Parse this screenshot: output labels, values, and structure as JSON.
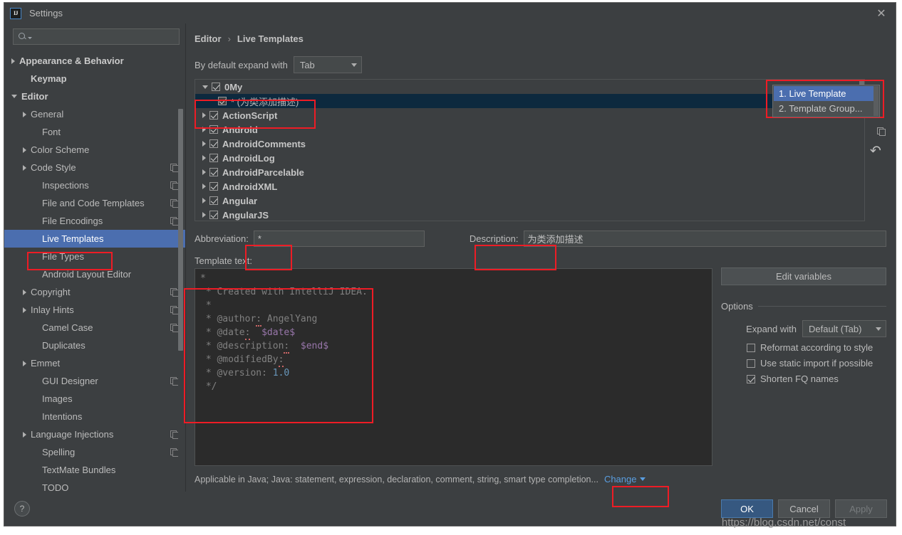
{
  "window": {
    "title": "Settings",
    "logo_text": "IJ",
    "close_label": "✕"
  },
  "search": {
    "value": "",
    "placeholder": ""
  },
  "sidebar": {
    "items": [
      {
        "label": "Appearance & Behavior",
        "arrow": "right",
        "bold": true,
        "indent": 0,
        "copy": false,
        "selected": false
      },
      {
        "label": "Keymap",
        "arrow": "none",
        "bold": true,
        "indent": 1,
        "copy": false,
        "selected": false
      },
      {
        "label": "Editor",
        "arrow": "down",
        "bold": true,
        "indent": 0,
        "copy": false,
        "selected": false
      },
      {
        "label": "General",
        "arrow": "right",
        "bold": false,
        "indent": 1,
        "copy": false,
        "selected": false
      },
      {
        "label": "Font",
        "arrow": "none",
        "bold": false,
        "indent": 2,
        "copy": false,
        "selected": false
      },
      {
        "label": "Color Scheme",
        "arrow": "right",
        "bold": false,
        "indent": 1,
        "copy": false,
        "selected": false
      },
      {
        "label": "Code Style",
        "arrow": "right",
        "bold": false,
        "indent": 1,
        "copy": true,
        "selected": false
      },
      {
        "label": "Inspections",
        "arrow": "none",
        "bold": false,
        "indent": 2,
        "copy": true,
        "selected": false
      },
      {
        "label": "File and Code Templates",
        "arrow": "none",
        "bold": false,
        "indent": 2,
        "copy": true,
        "selected": false
      },
      {
        "label": "File Encodings",
        "arrow": "none",
        "bold": false,
        "indent": 2,
        "copy": true,
        "selected": false
      },
      {
        "label": "Live Templates",
        "arrow": "none",
        "bold": false,
        "indent": 2,
        "copy": false,
        "selected": true
      },
      {
        "label": "File Types",
        "arrow": "none",
        "bold": false,
        "indent": 2,
        "copy": false,
        "selected": false
      },
      {
        "label": "Android Layout Editor",
        "arrow": "none",
        "bold": false,
        "indent": 2,
        "copy": false,
        "selected": false
      },
      {
        "label": "Copyright",
        "arrow": "right",
        "bold": false,
        "indent": 1,
        "copy": true,
        "selected": false
      },
      {
        "label": "Inlay Hints",
        "arrow": "right",
        "bold": false,
        "indent": 1,
        "copy": true,
        "selected": false
      },
      {
        "label": "Camel Case",
        "arrow": "none",
        "bold": false,
        "indent": 2,
        "copy": true,
        "selected": false
      },
      {
        "label": "Duplicates",
        "arrow": "none",
        "bold": false,
        "indent": 2,
        "copy": false,
        "selected": false
      },
      {
        "label": "Emmet",
        "arrow": "right",
        "bold": false,
        "indent": 1,
        "copy": false,
        "selected": false
      },
      {
        "label": "GUI Designer",
        "arrow": "none",
        "bold": false,
        "indent": 2,
        "copy": true,
        "selected": false
      },
      {
        "label": "Images",
        "arrow": "none",
        "bold": false,
        "indent": 2,
        "copy": false,
        "selected": false
      },
      {
        "label": "Intentions",
        "arrow": "none",
        "bold": false,
        "indent": 2,
        "copy": false,
        "selected": false
      },
      {
        "label": "Language Injections",
        "arrow": "right",
        "bold": false,
        "indent": 1,
        "copy": true,
        "selected": false
      },
      {
        "label": "Spelling",
        "arrow": "none",
        "bold": false,
        "indent": 2,
        "copy": true,
        "selected": false
      },
      {
        "label": "TextMate Bundles",
        "arrow": "none",
        "bold": false,
        "indent": 2,
        "copy": false,
        "selected": false
      },
      {
        "label": "TODO",
        "arrow": "none",
        "bold": false,
        "indent": 2,
        "copy": false,
        "selected": false
      }
    ]
  },
  "breadcrumb": {
    "parent": "Editor",
    "separator": "›",
    "current": "Live Templates"
  },
  "expand": {
    "label": "By default expand with",
    "value": "Tab"
  },
  "templates": {
    "rows": [
      {
        "label": "0My",
        "arrow": "down",
        "checked": true,
        "child": false
      },
      {
        "label": "* (为类添加描述)",
        "arrow": "none",
        "checked": true,
        "child": true,
        "selected": true
      },
      {
        "label": "ActionScript",
        "arrow": "right",
        "checked": true,
        "child": false
      },
      {
        "label": "Android",
        "arrow": "right",
        "checked": true,
        "child": false
      },
      {
        "label": "AndroidComments",
        "arrow": "right",
        "checked": true,
        "child": false
      },
      {
        "label": "AndroidLog",
        "arrow": "right",
        "checked": true,
        "child": false
      },
      {
        "label": "AndroidParcelable",
        "arrow": "right",
        "checked": true,
        "child": false
      },
      {
        "label": "AndroidXML",
        "arrow": "right",
        "checked": true,
        "child": false
      },
      {
        "label": "Angular",
        "arrow": "right",
        "checked": true,
        "child": false
      },
      {
        "label": "AngularJS",
        "arrow": "right",
        "checked": true,
        "child": false
      }
    ]
  },
  "list_toolbar": {
    "add": "+",
    "remove": "−",
    "duplicate": "duplicate-icon",
    "revert": "↶"
  },
  "add_popup": {
    "items": [
      {
        "label": "1. Live Template",
        "selected": true
      },
      {
        "label": "2. Template Group...",
        "selected": false
      }
    ]
  },
  "fields": {
    "abbreviation_label": "Abbreviation:",
    "abbreviation_value": "*",
    "description_label": "Description:",
    "description_value": "为类添加描述"
  },
  "template_text": {
    "label": "Template text:",
    "lines": [
      [
        {
          "t": "*",
          "c": "c"
        }
      ],
      [
        {
          "t": " * Created with IntelliJ IDEA.",
          "c": "c"
        }
      ],
      [
        {
          "t": " *",
          "c": "c"
        }
      ],
      [
        {
          "t": " * @author",
          "c": "c"
        },
        {
          "t": ":",
          "c": "cs"
        },
        {
          "t": " AngelYang",
          "c": "c"
        }
      ],
      [
        {
          "t": " * @date",
          "c": "c"
        },
        {
          "t": ":",
          "c": "cs"
        },
        {
          "t": "  ",
          "c": "c"
        },
        {
          "t": "$date$",
          "c": "v"
        }
      ],
      [
        {
          "t": " * @description",
          "c": "c"
        },
        {
          "t": ":",
          "c": "cs"
        },
        {
          "t": "  ",
          "c": "c"
        },
        {
          "t": "$end$",
          "c": "v"
        }
      ],
      [
        {
          "t": " * @modifiedBy",
          "c": "c"
        },
        {
          "t": ":",
          "c": "cs"
        }
      ],
      [
        {
          "t": " * @version: ",
          "c": "c"
        },
        {
          "t": "1.0",
          "c": "n"
        }
      ],
      [
        {
          "t": " */",
          "c": "c"
        }
      ]
    ]
  },
  "edit_variables": {
    "label": "Edit variables"
  },
  "options": {
    "title": "Options",
    "expand_with_label": "Expand with",
    "expand_with_value": "Default (Tab)",
    "checkboxes": [
      {
        "label": "Reformat according to style",
        "checked": false
      },
      {
        "label": "Use static import if possible",
        "checked": false
      },
      {
        "label": "Shorten FQ names",
        "checked": true
      }
    ]
  },
  "applicable": {
    "text": "Applicable in Java; Java: statement, expression, declaration, comment, string, smart type completion...",
    "change_label": "Change"
  },
  "footer": {
    "help": "?",
    "ok": "OK",
    "cancel": "Cancel",
    "apply": "Apply"
  },
  "watermark": "https://blog.csdn.net/const",
  "colors": {
    "accent": "#4b6eaf",
    "highlight": "#ee1c25",
    "panel": "#3c3f41",
    "editor": "#2b2b2b",
    "link": "#5a9ee0"
  }
}
